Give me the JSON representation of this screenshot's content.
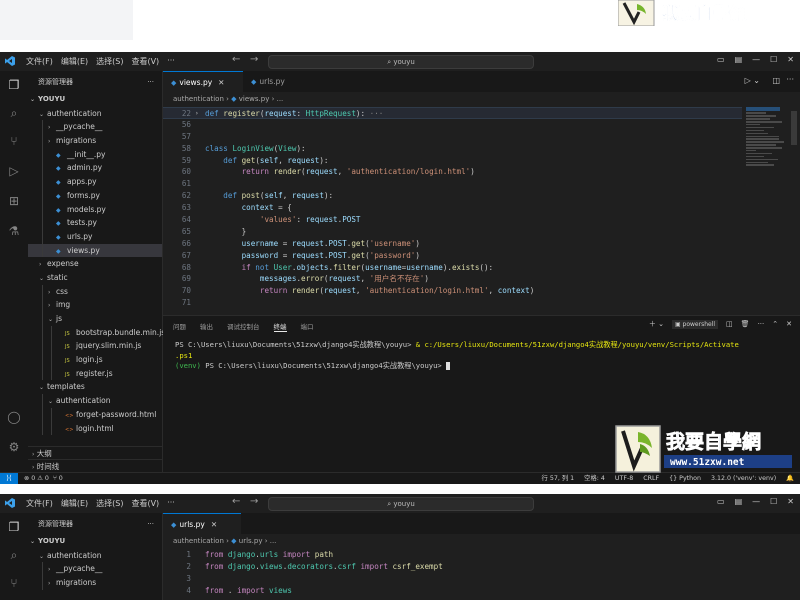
{
  "watermark": {
    "cn": "我要自學網",
    "url": "www.51zxw.net"
  },
  "window1": {
    "menu": [
      "文件(F)",
      "编辑(E)",
      "选择(S)",
      "查看(V)",
      "···"
    ],
    "search": "youyu",
    "sidebar_title": "资源管理器",
    "tree": [
      {
        "label": "YOUYU",
        "depth": 0,
        "kind": "root",
        "twisty": "⌄"
      },
      {
        "label": "authentication",
        "depth": 1,
        "kind": "folder",
        "twisty": "⌄"
      },
      {
        "label": "__pycache__",
        "depth": 2,
        "kind": "folder",
        "twisty": "›"
      },
      {
        "label": "migrations",
        "depth": 2,
        "kind": "folder",
        "twisty": "›"
      },
      {
        "label": "__init__.py",
        "depth": 2,
        "kind": "py"
      },
      {
        "label": "admin.py",
        "depth": 2,
        "kind": "py"
      },
      {
        "label": "apps.py",
        "depth": 2,
        "kind": "py"
      },
      {
        "label": "forms.py",
        "depth": 2,
        "kind": "py"
      },
      {
        "label": "models.py",
        "depth": 2,
        "kind": "py"
      },
      {
        "label": "tests.py",
        "depth": 2,
        "kind": "py"
      },
      {
        "label": "urls.py",
        "depth": 2,
        "kind": "py"
      },
      {
        "label": "views.py",
        "depth": 2,
        "kind": "py",
        "selected": true
      },
      {
        "label": "expense",
        "depth": 1,
        "kind": "folder",
        "twisty": "›"
      },
      {
        "label": "static",
        "depth": 1,
        "kind": "folder",
        "twisty": "⌄"
      },
      {
        "label": "css",
        "depth": 2,
        "kind": "folder",
        "twisty": "›"
      },
      {
        "label": "img",
        "depth": 2,
        "kind": "folder",
        "twisty": "›"
      },
      {
        "label": "js",
        "depth": 2,
        "kind": "folder",
        "twisty": "⌄"
      },
      {
        "label": "bootstrap.bundle.min.js",
        "depth": 3,
        "kind": "js"
      },
      {
        "label": "jquery.slim.min.js",
        "depth": 3,
        "kind": "js"
      },
      {
        "label": "login.js",
        "depth": 3,
        "kind": "js"
      },
      {
        "label": "register.js",
        "depth": 3,
        "kind": "js"
      },
      {
        "label": "templates",
        "depth": 1,
        "kind": "folder",
        "twisty": "⌄"
      },
      {
        "label": "authentication",
        "depth": 2,
        "kind": "folder",
        "twisty": "⌄"
      },
      {
        "label": "forget-password.html",
        "depth": 3,
        "kind": "html"
      },
      {
        "label": "login.html",
        "depth": 3,
        "kind": "html"
      }
    ],
    "outline_label": "大纲",
    "timeline_label": "时间线",
    "tabs": [
      {
        "label": "views.py",
        "active": true
      },
      {
        "label": "urls.py",
        "active": false
      }
    ],
    "breadcrumb": [
      "authentication",
      "views.py",
      "..."
    ],
    "code": [
      {
        "n": "22",
        "hl": true,
        "fold": "›",
        "tokens": [
          [
            "kw",
            "def "
          ],
          [
            "fn",
            "register"
          ],
          [
            "pun",
            "("
          ],
          [
            "var",
            "request"
          ],
          [
            "pun",
            ": "
          ],
          [
            "cls",
            "HttpRequest"
          ],
          [
            "pun",
            "):"
          ],
          [
            "ell",
            " ···"
          ]
        ]
      },
      {
        "n": "56",
        "tokens": []
      },
      {
        "n": "57",
        "tokens": []
      },
      {
        "n": "58",
        "tokens": [
          [
            "kw",
            "class "
          ],
          [
            "cls",
            "LoginView"
          ],
          [
            "pun",
            "("
          ],
          [
            "cls",
            "View"
          ],
          [
            "pun",
            "):"
          ]
        ]
      },
      {
        "n": "59",
        "tokens": [
          [
            "pun",
            "    "
          ],
          [
            "kw",
            "def "
          ],
          [
            "fn",
            "get"
          ],
          [
            "pun",
            "("
          ],
          [
            "var",
            "self"
          ],
          [
            "pun",
            ", "
          ],
          [
            "var",
            "request"
          ],
          [
            "pun",
            "):"
          ]
        ]
      },
      {
        "n": "60",
        "tokens": [
          [
            "pun",
            "        "
          ],
          [
            "kw2",
            "return "
          ],
          [
            "fn",
            "render"
          ],
          [
            "pun",
            "("
          ],
          [
            "var",
            "request"
          ],
          [
            "pun",
            ", "
          ],
          [
            "str",
            "'authentication/login.html'"
          ],
          [
            "pun",
            ")"
          ]
        ]
      },
      {
        "n": "61",
        "tokens": []
      },
      {
        "n": "62",
        "tokens": [
          [
            "pun",
            "    "
          ],
          [
            "kw",
            "def "
          ],
          [
            "fn",
            "post"
          ],
          [
            "pun",
            "("
          ],
          [
            "var",
            "self"
          ],
          [
            "pun",
            ", "
          ],
          [
            "var",
            "request"
          ],
          [
            "pun",
            "):"
          ]
        ]
      },
      {
        "n": "63",
        "tokens": [
          [
            "pun",
            "        "
          ],
          [
            "var",
            "context"
          ],
          [
            "pun",
            " = {"
          ]
        ]
      },
      {
        "n": "64",
        "tokens": [
          [
            "pun",
            "            "
          ],
          [
            "str",
            "'values'"
          ],
          [
            "pun",
            ": "
          ],
          [
            "var",
            "request"
          ],
          [
            "pun",
            "."
          ],
          [
            "var",
            "POST"
          ]
        ]
      },
      {
        "n": "65",
        "tokens": [
          [
            "pun",
            "        }"
          ]
        ]
      },
      {
        "n": "66",
        "tokens": [
          [
            "pun",
            "        "
          ],
          [
            "var",
            "username"
          ],
          [
            "pun",
            " = "
          ],
          [
            "var",
            "request"
          ],
          [
            "pun",
            "."
          ],
          [
            "var",
            "POST"
          ],
          [
            "pun",
            "."
          ],
          [
            "fn",
            "get"
          ],
          [
            "pun",
            "("
          ],
          [
            "str",
            "'username'"
          ],
          [
            "pun",
            ")"
          ]
        ]
      },
      {
        "n": "67",
        "tokens": [
          [
            "pun",
            "        "
          ],
          [
            "var",
            "password"
          ],
          [
            "pun",
            " = "
          ],
          [
            "var",
            "request"
          ],
          [
            "pun",
            "."
          ],
          [
            "var",
            "POST"
          ],
          [
            "pun",
            "."
          ],
          [
            "fn",
            "get"
          ],
          [
            "pun",
            "("
          ],
          [
            "str",
            "'password'"
          ],
          [
            "pun",
            ")"
          ]
        ]
      },
      {
        "n": "68",
        "tokens": [
          [
            "pun",
            "        "
          ],
          [
            "kw2",
            "if "
          ],
          [
            "kw",
            "not "
          ],
          [
            "cls",
            "User"
          ],
          [
            "pun",
            "."
          ],
          [
            "var",
            "objects"
          ],
          [
            "pun",
            "."
          ],
          [
            "fn",
            "filter"
          ],
          [
            "pun",
            "("
          ],
          [
            "var",
            "username"
          ],
          [
            "pun",
            "="
          ],
          [
            "var",
            "username"
          ],
          [
            "pun",
            ")."
          ],
          [
            "fn",
            "exists"
          ],
          [
            "pun",
            "():"
          ]
        ]
      },
      {
        "n": "69",
        "tokens": [
          [
            "pun",
            "            "
          ],
          [
            "var",
            "messages"
          ],
          [
            "pun",
            "."
          ],
          [
            "fn",
            "error"
          ],
          [
            "pun",
            "("
          ],
          [
            "var",
            "request"
          ],
          [
            "pun",
            ", "
          ],
          [
            "str",
            "'用户名不存在'"
          ],
          [
            "pun",
            ")"
          ]
        ]
      },
      {
        "n": "70",
        "tokens": [
          [
            "pun",
            "            "
          ],
          [
            "kw2",
            "return "
          ],
          [
            "fn",
            "render"
          ],
          [
            "pun",
            "("
          ],
          [
            "var",
            "request"
          ],
          [
            "pun",
            ", "
          ],
          [
            "str",
            "'authentication/login.html'"
          ],
          [
            "pun",
            ", "
          ],
          [
            "var",
            "context"
          ],
          [
            "pun",
            ")"
          ]
        ]
      },
      {
        "n": "71",
        "tokens": []
      }
    ],
    "panel_tabs": [
      "问题",
      "输出",
      "调试控制台",
      "终端",
      "端口"
    ],
    "panel_active": "终端",
    "shell": "powershell",
    "terminal": {
      "line1_prompt": "PS C:\\Users\\liuxu\\Documents\\51zxw\\django4实战教程\\youyu> ",
      "line1_cmd": "& c:/Users/liuxu/Documents/51zxw/django4实战教程/youyu/venv/Scripts/Activate",
      "line2": ".ps1",
      "line3_env": "(venv)",
      "line3_prompt": " PS C:\\Users\\liuxu\\Documents\\51zxw\\django4实战教程\\youyu> "
    },
    "status": {
      "problems": "⊗ 0 ⚠ 0",
      "ports": "⑂ 0",
      "position": "行 57, 列 1",
      "spaces": "空格: 4",
      "encoding": "UTF-8",
      "eol": "CRLF",
      "language": "{} Python",
      "interpreter": "3.12.0 ('venv': venv)"
    }
  },
  "window2": {
    "menu": [
      "文件(F)",
      "编辑(E)",
      "选择(S)",
      "查看(V)",
      "···"
    ],
    "search": "youyu",
    "sidebar_title": "资源管理器",
    "tree": [
      {
        "label": "YOUYU",
        "depth": 0,
        "kind": "root",
        "twisty": "⌄"
      },
      {
        "label": "authentication",
        "depth": 1,
        "kind": "folder",
        "twisty": "⌄"
      },
      {
        "label": "__pycache__",
        "depth": 2,
        "kind": "folder",
        "twisty": "›"
      },
      {
        "label": "migrations",
        "depth": 2,
        "kind": "folder",
        "twisty": "›"
      }
    ],
    "tabs": [
      {
        "label": "urls.py",
        "active": true
      }
    ],
    "breadcrumb": [
      "authentication",
      "urls.py",
      "..."
    ],
    "code": [
      {
        "n": "1",
        "tokens": [
          [
            "kw2",
            "from "
          ],
          [
            "cls",
            "django"
          ],
          [
            "pun",
            "."
          ],
          [
            "cls",
            "urls"
          ],
          [
            "kw2",
            " import "
          ],
          [
            "fn",
            "path"
          ]
        ]
      },
      {
        "n": "2",
        "tokens": [
          [
            "kw2",
            "from "
          ],
          [
            "cls",
            "django"
          ],
          [
            "pun",
            "."
          ],
          [
            "cls",
            "views"
          ],
          [
            "pun",
            "."
          ],
          [
            "cls",
            "decorators"
          ],
          [
            "pun",
            "."
          ],
          [
            "cls",
            "csrf"
          ],
          [
            "kw2",
            " import "
          ],
          [
            "fn",
            "csrf_exempt"
          ]
        ]
      },
      {
        "n": "3",
        "tokens": []
      },
      {
        "n": "4",
        "tokens": [
          [
            "kw2",
            "from "
          ],
          [
            "pun",
            ". "
          ],
          [
            "kw2",
            "import "
          ],
          [
            "cls",
            "views"
          ]
        ]
      }
    ]
  }
}
